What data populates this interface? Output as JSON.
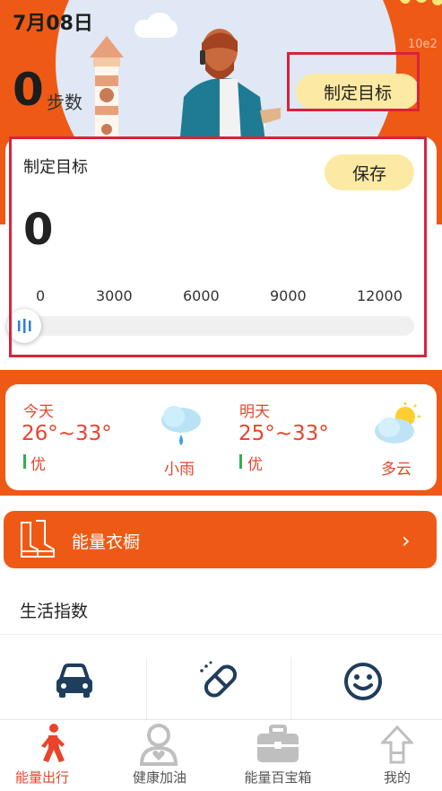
{
  "header": {
    "date": "7月08日",
    "steps_value": "0",
    "steps_unit": "步数",
    "faint_text": "10e2",
    "goal_button": "制定目标"
  },
  "goal_card": {
    "title": "制定目标",
    "save_button": "保存",
    "value": "0",
    "ticks": [
      "0",
      "3000",
      "6000",
      "9000",
      "12000"
    ],
    "slider_value": 0
  },
  "weather": {
    "today": {
      "day": "今天",
      "temp": "26°~33°",
      "aqi": "优",
      "condition": "小雨"
    },
    "tomorrow": {
      "day": "明天",
      "temp": "25°~33°",
      "aqi": "优",
      "condition": "多云"
    }
  },
  "wardrobe": {
    "label": "能量衣橱"
  },
  "life_index": {
    "title": "生活指数",
    "icons": [
      "car-icon",
      "pill-icon",
      "smiley-icon"
    ]
  },
  "tabs": [
    {
      "label": "能量出行",
      "icon": "walking-person-icon",
      "active": true
    },
    {
      "label": "健康加油",
      "icon": "health-icon",
      "active": false
    },
    {
      "label": "能量百宝箱",
      "icon": "toolbox-icon",
      "active": false
    },
    {
      "label": "我的",
      "icon": "home-arrow-icon",
      "active": false
    }
  ],
  "colors": {
    "brand_orange": "#ee5a15",
    "button_yellow": "#fce9a3",
    "highlight_red": "#d8233a",
    "weather_red": "#e8442b",
    "aqi_green": "#2fb24a",
    "icon_navy": "#1f3d5c"
  }
}
